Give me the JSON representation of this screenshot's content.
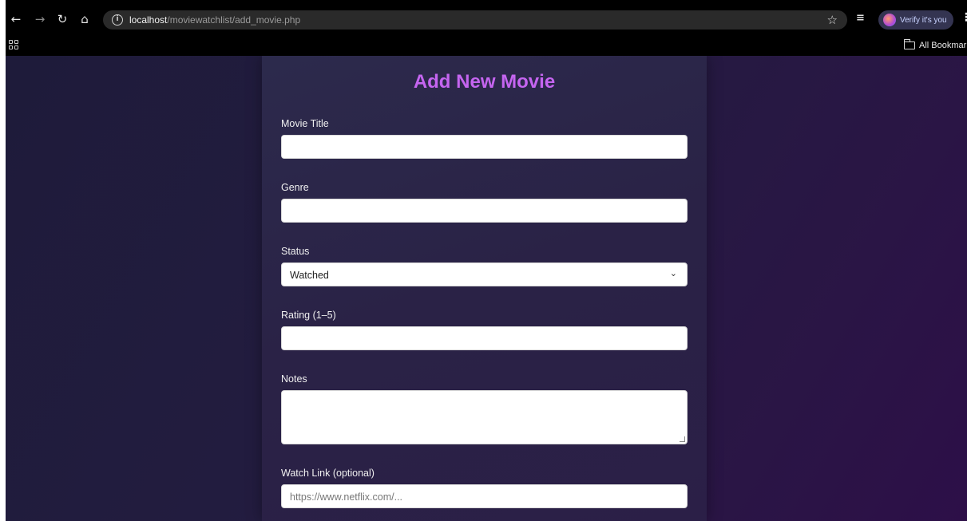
{
  "browser": {
    "url_host": "localhost",
    "url_path": "/moviewatchlist/add_movie.php",
    "profile_chip_label": "Verify it's you",
    "bookmarks_label": "All Bookmarks",
    "icons": {
      "back": "arrow-left-icon",
      "forward": "arrow-right-icon",
      "reload": "reload-icon",
      "home": "home-icon",
      "site_info": "info-icon",
      "bookmark": "star-icon",
      "tab_search": "tab-search-icon",
      "menu": "kebab-menu-icon",
      "apps": "apps-grid-icon",
      "folder": "folder-icon"
    }
  },
  "form": {
    "title": "Add New Movie",
    "title_color": "#c565f0",
    "fields": {
      "movie_title": {
        "label": "Movie Title",
        "value": ""
      },
      "genre": {
        "label": "Genre",
        "value": ""
      },
      "status": {
        "label": "Status",
        "selected": "Watched"
      },
      "rating": {
        "label": "Rating (1–5)",
        "value": ""
      },
      "notes": {
        "label": "Notes",
        "value": ""
      },
      "watch_link": {
        "label": "Watch Link (optional)",
        "placeholder": "https://www.netflix.com/..."
      }
    }
  }
}
